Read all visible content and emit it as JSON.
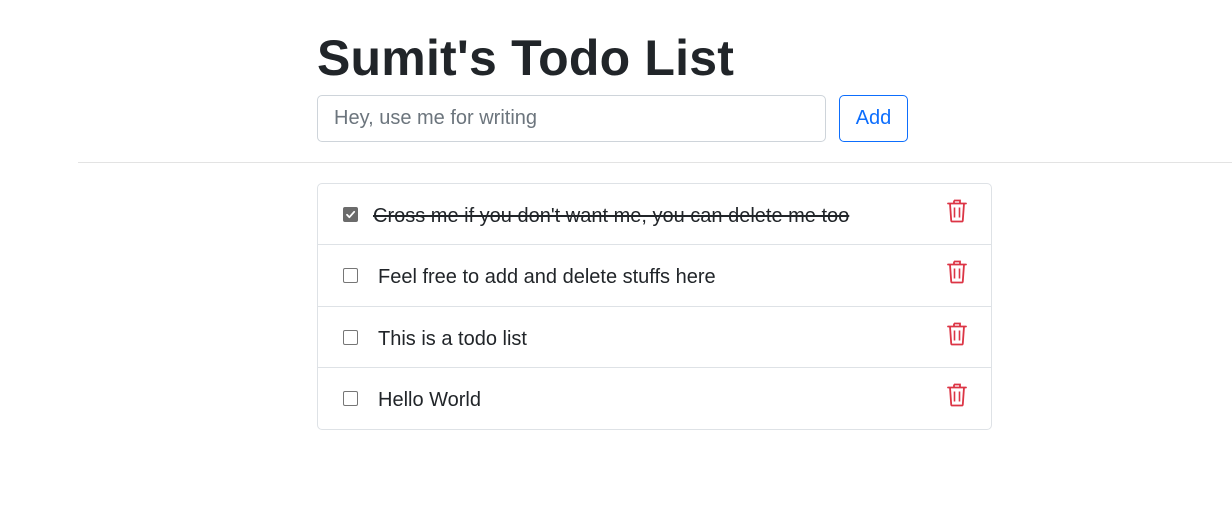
{
  "page_title": "Sumit's Todo List",
  "input": {
    "placeholder": "Hey, use me for writing",
    "value": ""
  },
  "add_button_label": "Add",
  "colors": {
    "accent": "#0d6efd",
    "delete": "#dc3545",
    "text": "#212529"
  },
  "todos": [
    {
      "text": "Cross me if you don't want me, you can delete me too",
      "done": true,
      "delete_icon": "trash-icon"
    },
    {
      "text": "Feel free to add and delete stuffs here",
      "done": false,
      "delete_icon": "trash-icon"
    },
    {
      "text": "This is a todo list",
      "done": false,
      "delete_icon": "trash-icon"
    },
    {
      "text": "Hello World",
      "done": false,
      "delete_icon": "trash-icon"
    }
  ]
}
